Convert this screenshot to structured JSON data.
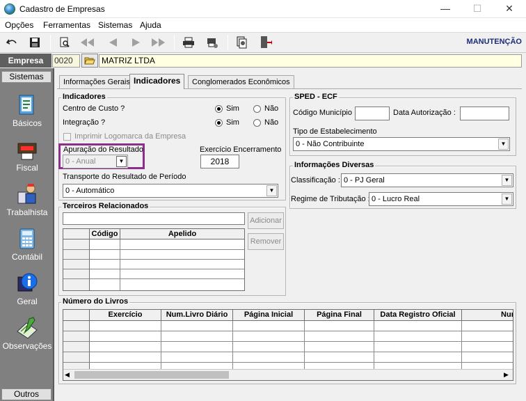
{
  "window": {
    "title": "Cadastro de Empresas",
    "controls": [
      "—",
      "☐",
      "✕"
    ]
  },
  "menu": [
    "Opções",
    "Ferramentas",
    "Sistemas",
    "Ajuda"
  ],
  "toolbar": {
    "mode": "MANUTENÇÃO"
  },
  "empresa": {
    "label": "Empresa",
    "code": "0020",
    "name": "MATRIZ LTDA"
  },
  "sidebar": {
    "header": "Sistemas",
    "footer": "Outros",
    "items": [
      {
        "label": "Básicos",
        "icon": "notebook-icon"
      },
      {
        "label": "Fiscal",
        "icon": "receipt-printer-icon"
      },
      {
        "label": "Trabalhista",
        "icon": "worker-icon"
      },
      {
        "label": "Contábil",
        "icon": "calculator-icon"
      },
      {
        "label": "Geral",
        "icon": "info-icon"
      },
      {
        "label": "Observações",
        "icon": "notepad-pencil-icon"
      }
    ]
  },
  "tabs": [
    "Informações Gerais",
    "Indicadores",
    "Conglomerados Econômicos"
  ],
  "indicadores": {
    "title": "Indicadores",
    "centro_custo": {
      "label": "Centro de Custo ?",
      "sim": "Sim",
      "nao": "Não",
      "selected": "Sim"
    },
    "integracao": {
      "label": "Integração ?",
      "sim": "Sim",
      "nao": "Não",
      "selected": "Sim"
    },
    "imprimir_logo": "Imprimir Logomarca da Empresa",
    "apuracao": {
      "label": "Apuração do Resultado",
      "value": "0 - Anual"
    },
    "exercicio": {
      "label": "Exercício Encerramento",
      "value": "2018"
    },
    "transporte": {
      "label": "Transporte do Resultado de Período",
      "value": "0 - Automático"
    }
  },
  "terceiros": {
    "title": "Terceiros Relacionados",
    "columns": [
      "Código",
      "Apelido"
    ],
    "add_button": "Adicionar",
    "remove_button": "Remover"
  },
  "sped": {
    "title": "SPED - ECF",
    "codigo_municipio": "Código Município :",
    "data_autorizacao": "Data Autorização :",
    "tipo_estab": {
      "label": "Tipo de Estabelecimento",
      "value": "0 - Não Contribuinte"
    }
  },
  "info_diversas": {
    "title": "Informações Diversas",
    "classificacao": {
      "label": "Classificação :",
      "value": "0 - PJ Geral"
    },
    "regime": {
      "label": "Regime de Tributação :",
      "value": "0 - Lucro Real"
    }
  },
  "livros": {
    "title": "Número do Livros",
    "columns": [
      "Exercício",
      "Num.Livro Diário",
      "Página Inicial",
      "Página Final",
      "Data Registro Oficial",
      "Nur"
    ]
  },
  "colors": {
    "highlight": "#8b2f8b",
    "sidebar": "#808080",
    "mode_text": "#1a2c7a"
  }
}
